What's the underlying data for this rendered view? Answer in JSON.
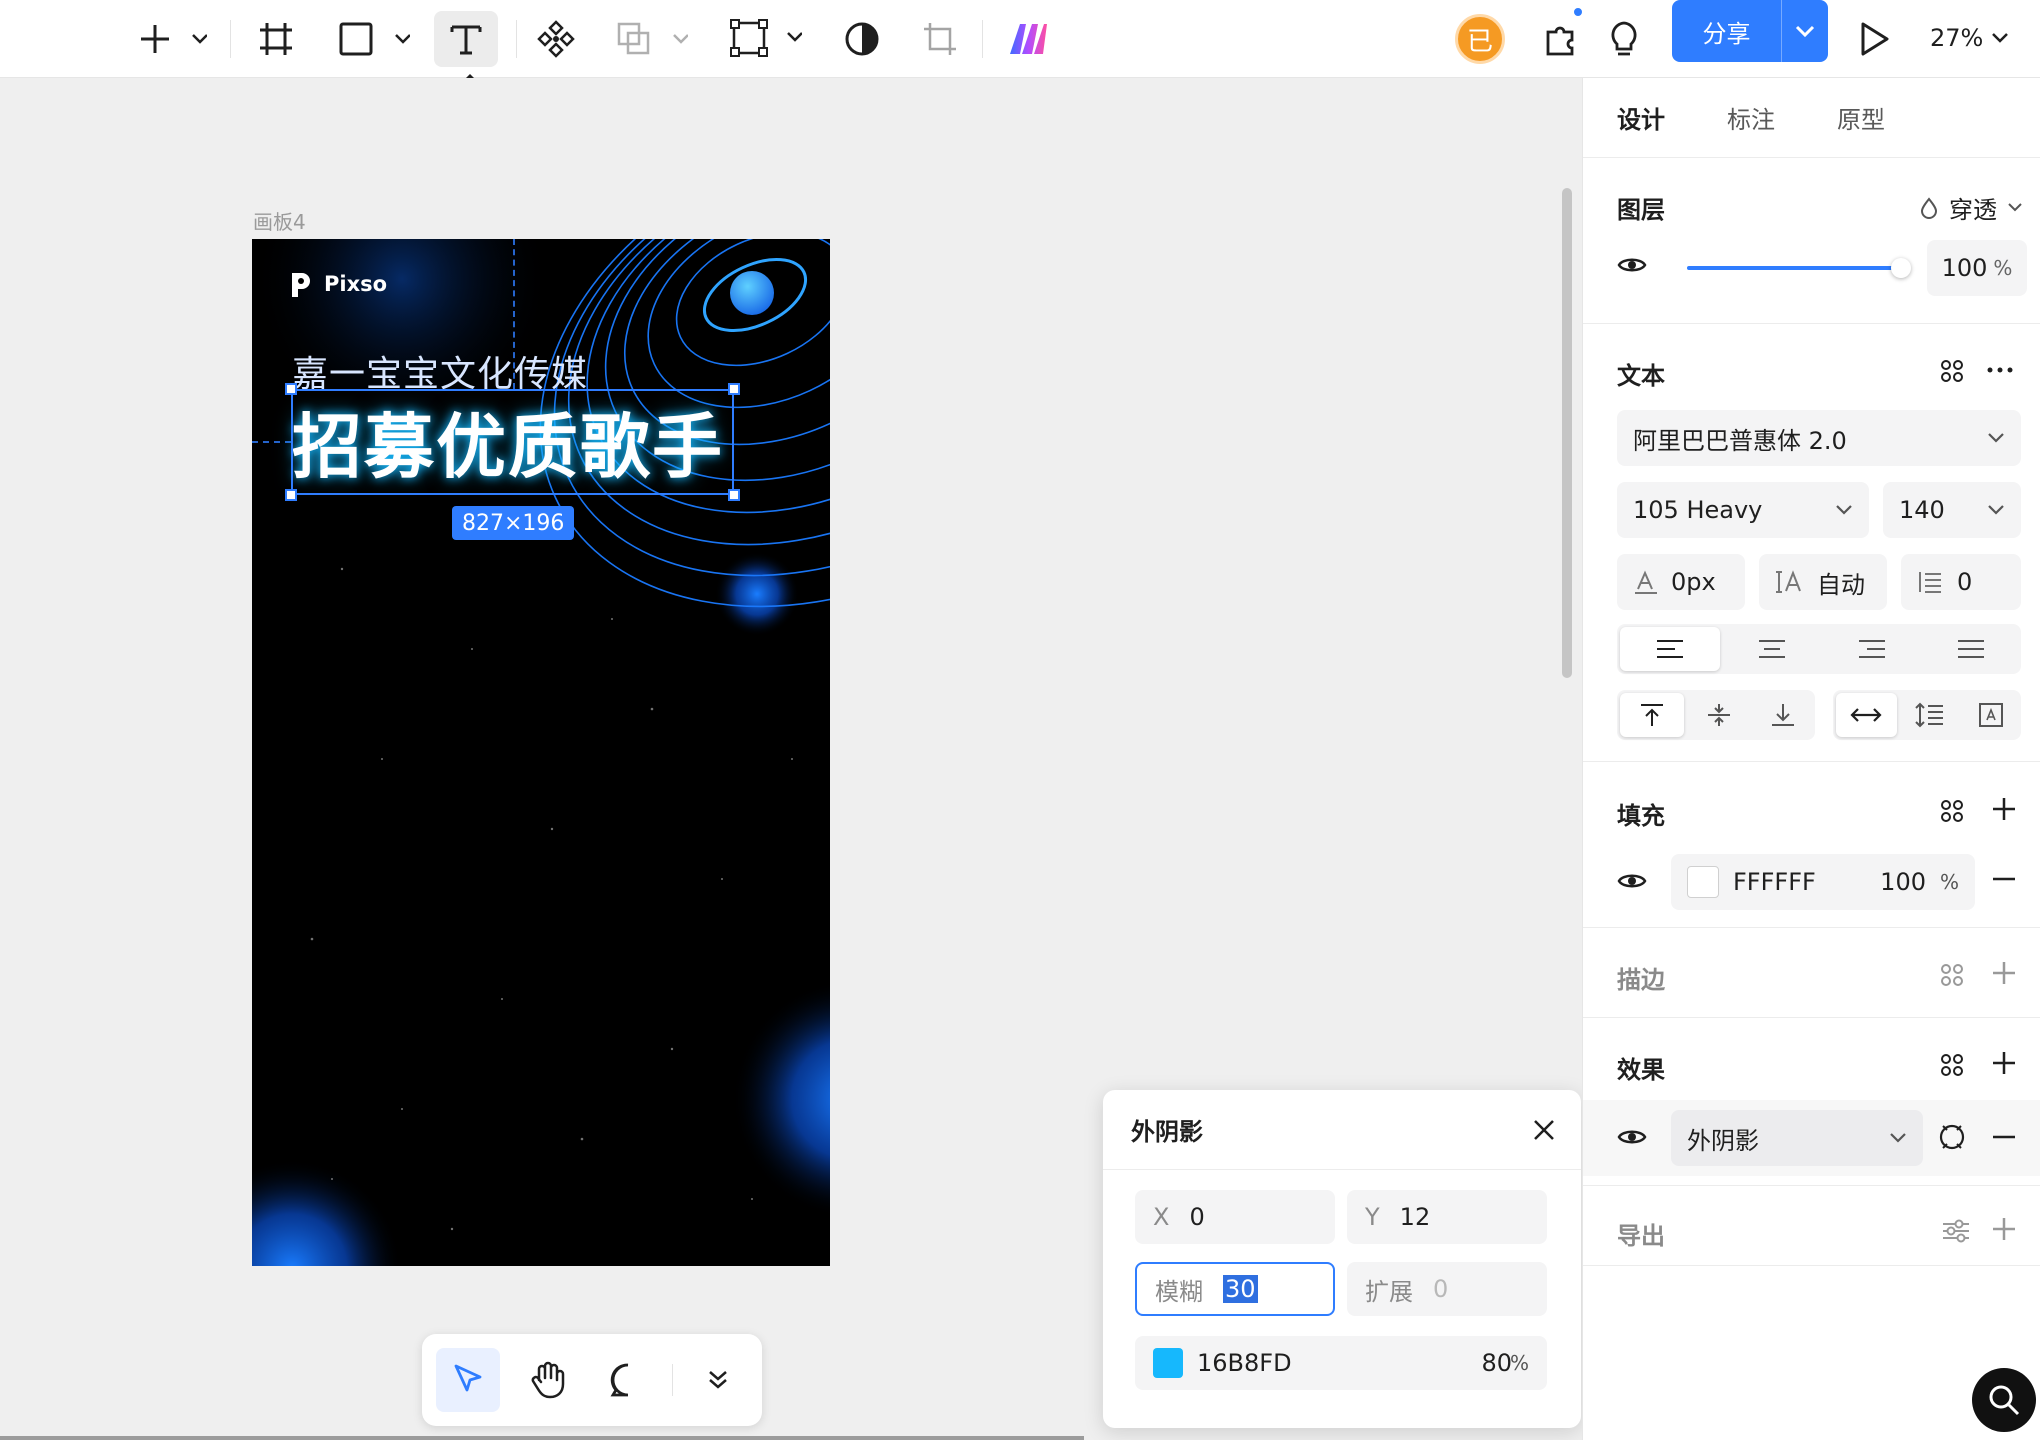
{
  "toolbar": {
    "tooltip_label": "文本",
    "tooltip_key": "T",
    "avatar_initial": "已",
    "share_label": "分享",
    "zoom": "27%"
  },
  "canvas": {
    "artboard_name": "画板4",
    "brand_name": "Pixso",
    "subtitle": "嘉一宝宝文化传媒",
    "headline": "招募优质歌手",
    "selection_size": "827×196"
  },
  "shadow_popover": {
    "title": "外阴影",
    "x_label": "X",
    "x_value": "0",
    "y_label": "Y",
    "y_value": "12",
    "blur_label": "模糊",
    "blur_value": "30",
    "spread_label": "扩展",
    "spread_value": "0",
    "color_hex": "16B8FD",
    "color_swatch": "#16B8FD",
    "opacity": "80",
    "opacity_unit": "%"
  },
  "panel": {
    "tabs": [
      "设计",
      "标注",
      "原型"
    ],
    "layer": {
      "title": "图层",
      "blend_mode": "穿透",
      "opacity": "100",
      "opacity_unit": "%",
      "opacity_level": 1.0
    },
    "text": {
      "title": "文本",
      "font_family": "阿里巴巴普惠体 2.0",
      "font_weight": "105 Heavy",
      "font_size": "140",
      "letter_spacing": "0px",
      "line_height": "自动",
      "paragraph_spacing": "0"
    },
    "fill": {
      "title": "填充",
      "hex": "FFFFFF",
      "opacity": "100",
      "unit": "%",
      "swatch": "#FFFFFF"
    },
    "stroke": {
      "title": "描边"
    },
    "effects": {
      "title": "效果",
      "effect_type": "外阴影"
    },
    "export": {
      "title": "导出"
    }
  },
  "colors": {
    "accent": "#2F7DFF",
    "avatar": "#F59A23"
  }
}
